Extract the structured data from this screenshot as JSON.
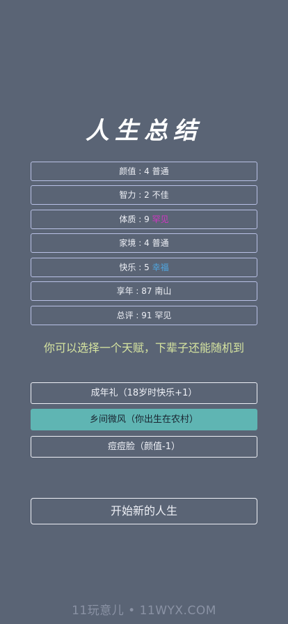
{
  "title": "人生总结",
  "stats": [
    {
      "label": "颜值",
      "value": "4",
      "rating": "普通",
      "rating_color": "#eef0f6"
    },
    {
      "label": "智力",
      "value": "2",
      "rating": "不佳",
      "rating_color": "#eef0f6"
    },
    {
      "label": "体质",
      "value": "9",
      "rating": "罕见",
      "rating_color": "#d633c7"
    },
    {
      "label": "家境",
      "value": "4",
      "rating": "普通",
      "rating_color": "#eef0f6"
    },
    {
      "label": "快乐",
      "value": "5",
      "rating": "幸福",
      "rating_color": "#4fa6e0"
    },
    {
      "label": "享年",
      "value": "87",
      "rating": "南山",
      "rating_color": "#eef0f6"
    },
    {
      "label": "总评",
      "value": "91",
      "rating": "罕见",
      "rating_color": "#eef0f6"
    }
  ],
  "prompt": "你可以选择一个天赋，下辈子还能随机到",
  "talents": [
    {
      "label": "成年礼（18岁时快乐+1）",
      "selected": false
    },
    {
      "label": "乡间微风（你出生在农村）",
      "selected": true
    },
    {
      "label": "痘痘脸（颜值-1）",
      "selected": false
    }
  ],
  "start_button": "开始新的人生",
  "watermark": "11玩意儿 • 11WYX.COM",
  "colors": {
    "background": "#5a6475",
    "selected_talent": "#5fb5b3",
    "prompt_text": "#d6e4a0"
  }
}
